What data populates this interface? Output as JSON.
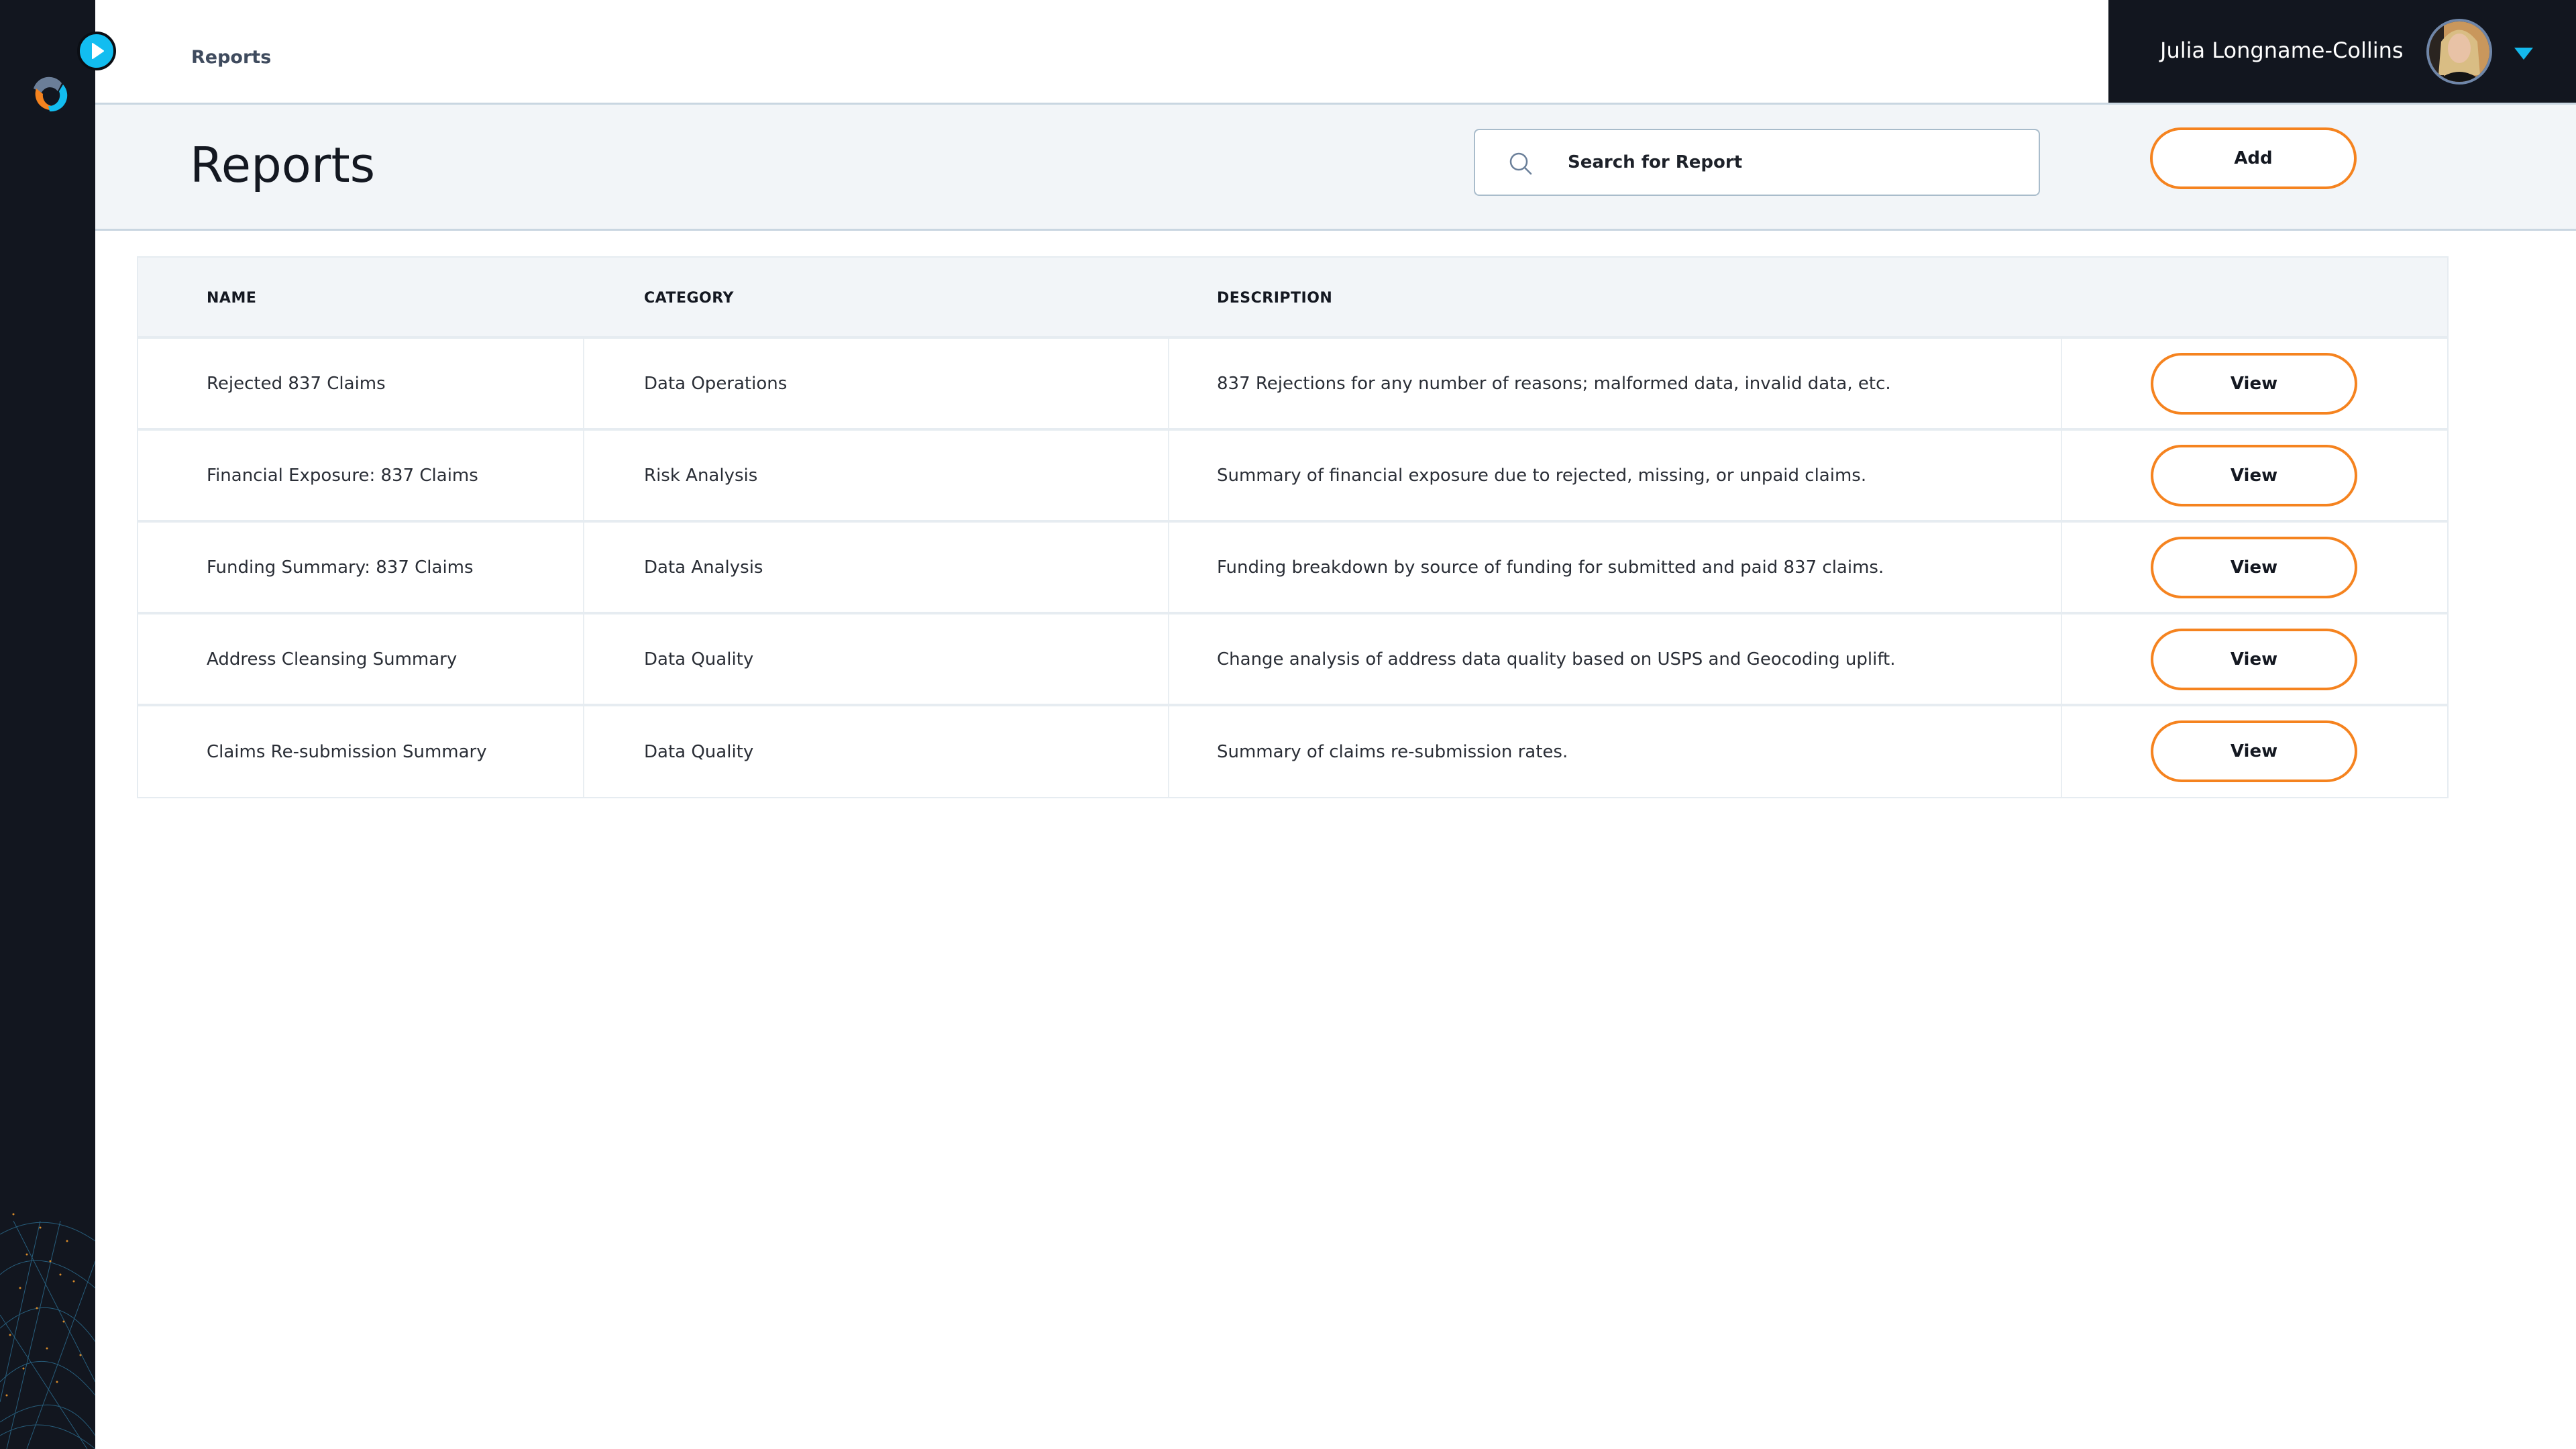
{
  "app": {
    "logo": "orbit-logo-icon",
    "expand_icon": "chevron-right-icon"
  },
  "breadcrumb": {
    "current": "Reports"
  },
  "user": {
    "name": "Julia Longname-Collins",
    "avatar": "user-avatar",
    "menu_icon": "caret-down-icon"
  },
  "header": {
    "title": "Reports",
    "search": {
      "placeholder": "Search for Report",
      "value": "",
      "icon": "search-icon"
    },
    "add_label": "Add"
  },
  "colors": {
    "accent_orange": "#f5831f",
    "accent_cyan": "#12bdf0",
    "sidebar_bg": "#12161f",
    "header_bg": "#f2f5f8"
  },
  "table": {
    "columns": [
      "NAME",
      "CATEGORY",
      "DESCRIPTION"
    ],
    "rows": [
      {
        "name": "Rejected 837 Claims",
        "category": "Data Operations",
        "description": "837 Rejections for any number of reasons; malformed data, invalid data, etc.",
        "action": "View"
      },
      {
        "name": "Financial Exposure: 837 Claims",
        "category": "Risk Analysis",
        "description": "Summary of financial exposure due to rejected, missing, or unpaid claims.",
        "action": "View"
      },
      {
        "name": "Funding Summary: 837 Claims",
        "category": "Data Analysis",
        "description": "Funding breakdown by source of funding for submitted and paid 837 claims.",
        "action": "View"
      },
      {
        "name": "Address Cleansing Summary",
        "category": "Data Quality",
        "description": "Change analysis of address data quality based on USPS and Geocoding uplift.",
        "action": "View"
      },
      {
        "name": "Claims Re-submission Summary",
        "category": "Data Quality",
        "description": "Summary of claims re-submission rates.",
        "action": "View"
      }
    ]
  }
}
